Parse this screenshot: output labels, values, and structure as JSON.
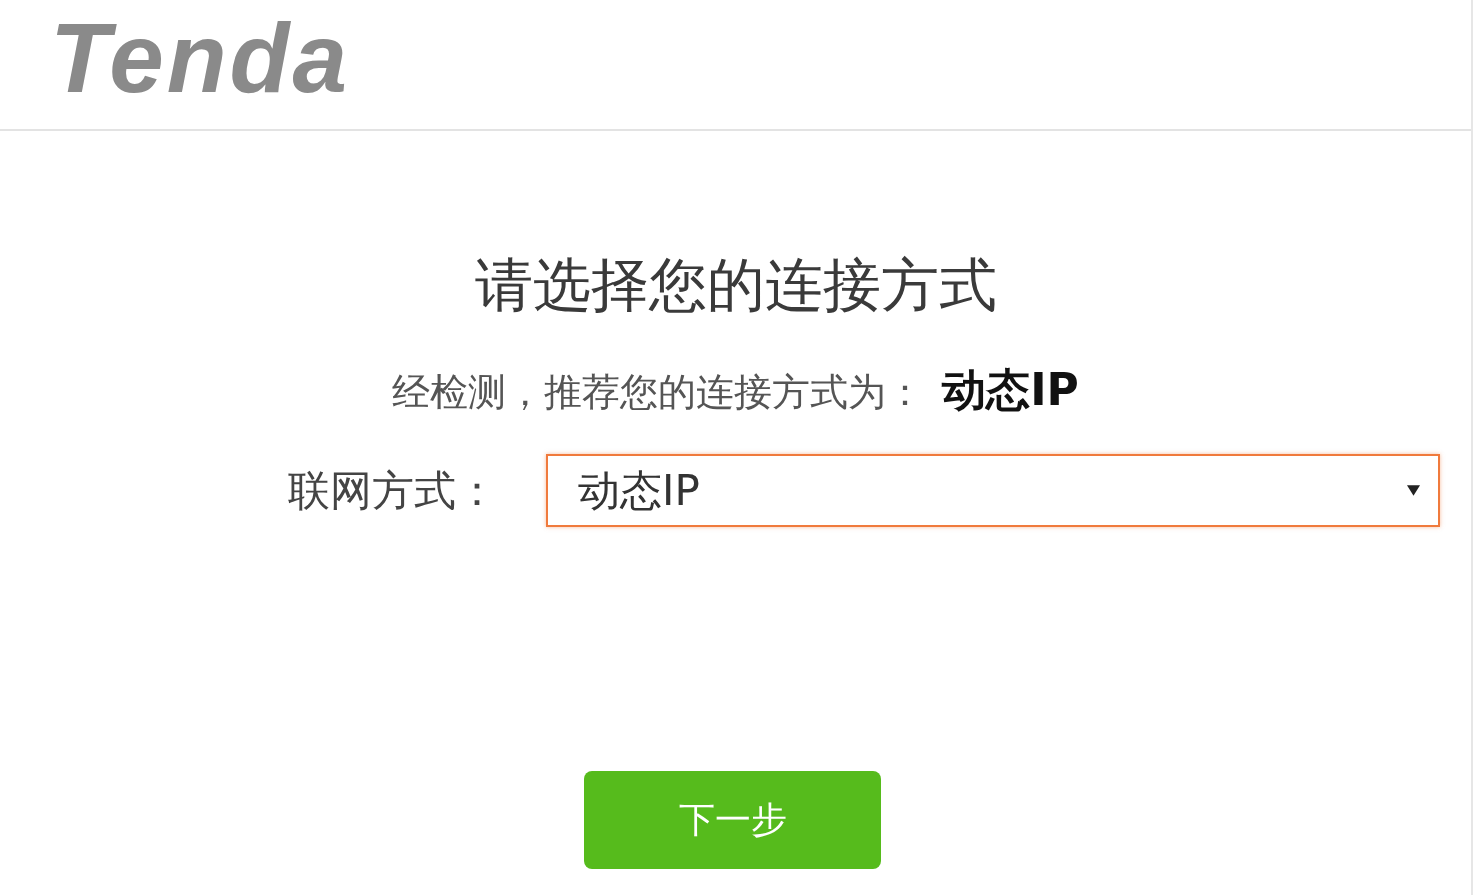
{
  "header": {
    "logo": "Tenda"
  },
  "title": "请选择您的连接方式",
  "detection": {
    "text": "经检测，推荐您的连接方式为：",
    "result": "动态IP"
  },
  "connection_type": {
    "label": "联网方式：",
    "value": "动态IP",
    "focused": true
  },
  "next_button": {
    "label": "下一步"
  }
}
